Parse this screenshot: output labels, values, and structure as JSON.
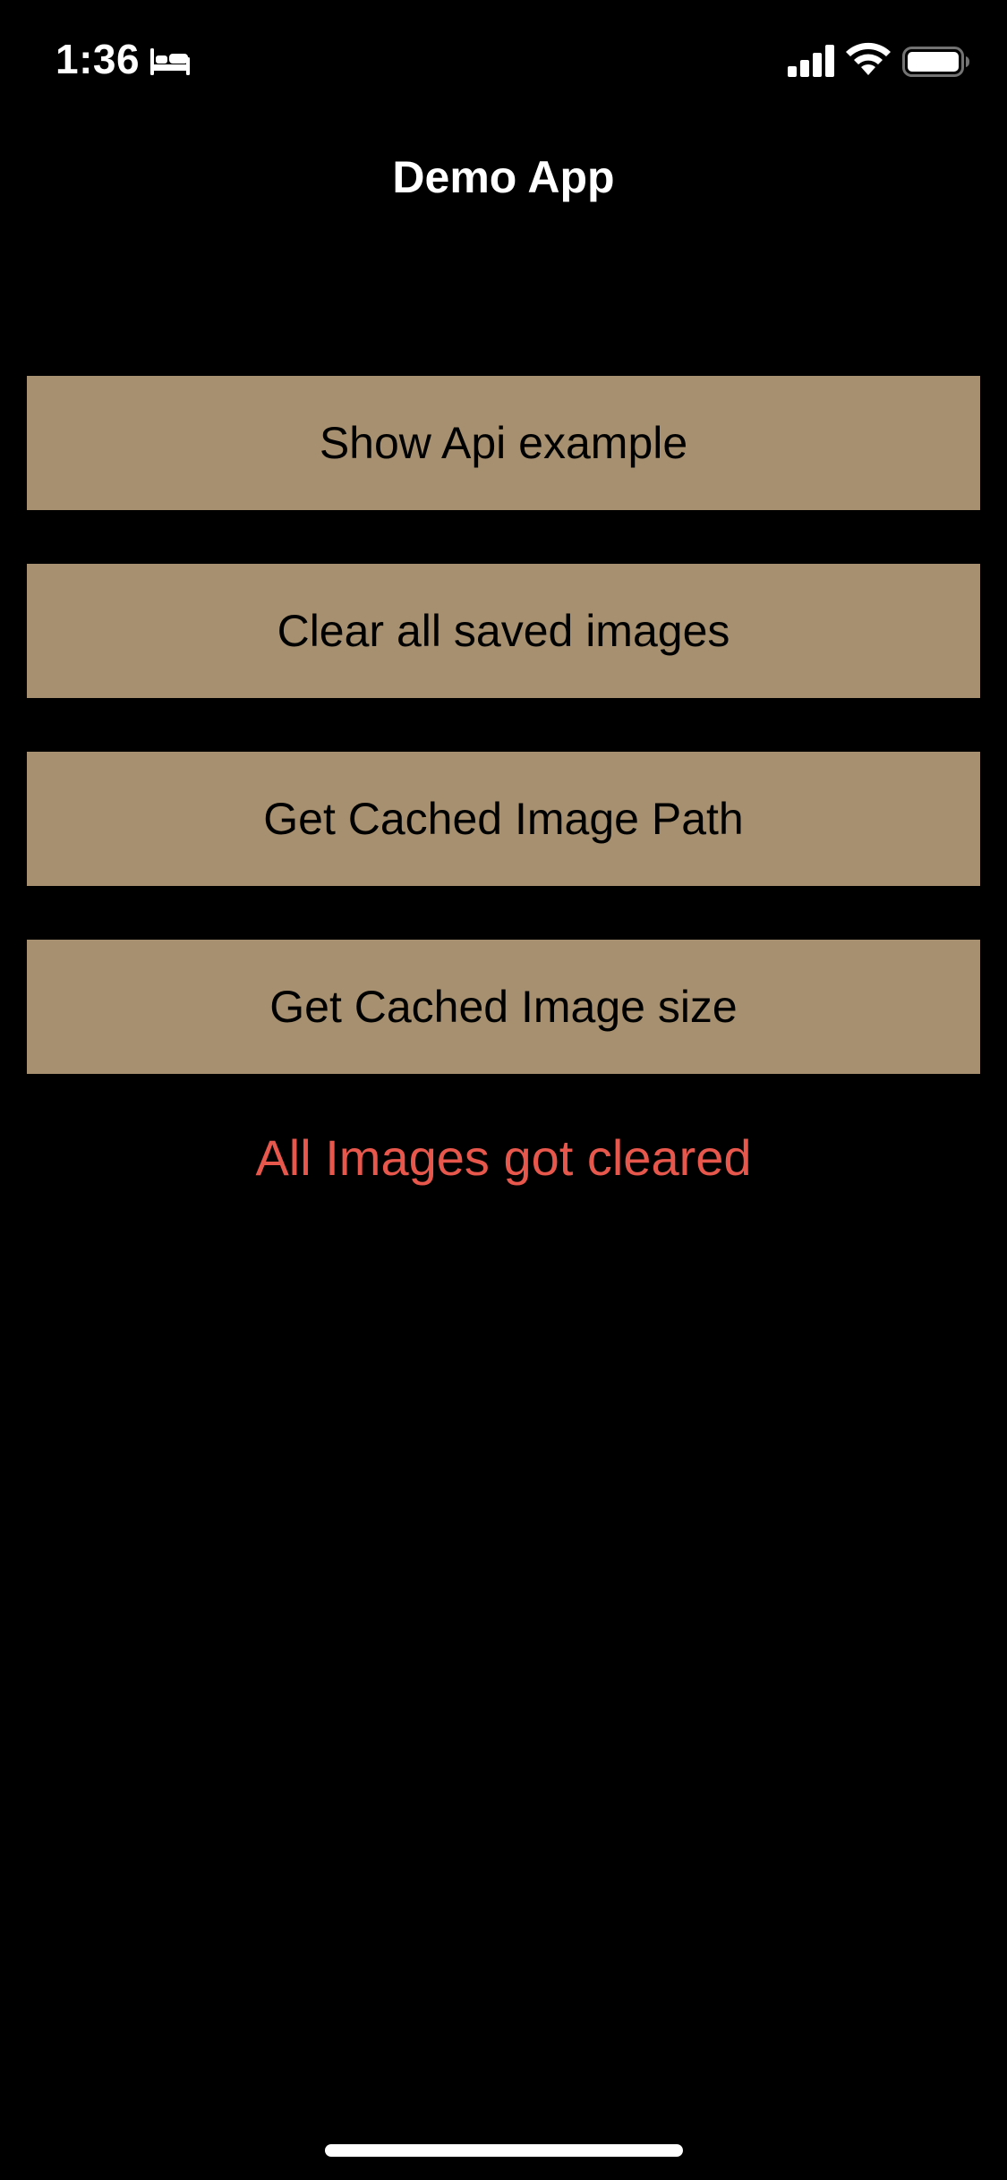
{
  "status_bar": {
    "time": "1:36",
    "sleep_icon": "bed-icon",
    "cellular_icon": "cellular-signal-icon",
    "wifi_icon": "wifi-icon",
    "battery_icon": "battery-icon"
  },
  "nav": {
    "title": "Demo App"
  },
  "buttons": [
    {
      "label": "Show Api example"
    },
    {
      "label": "Clear all saved images"
    },
    {
      "label": "Get Cached Image Path"
    },
    {
      "label": "Get Cached Image size"
    }
  ],
  "status_message": "All Images got cleared",
  "colors": {
    "background": "#000000",
    "button": "#a6906f",
    "button_text": "#000000",
    "message": "#e8574c",
    "title": "#ffffff"
  }
}
